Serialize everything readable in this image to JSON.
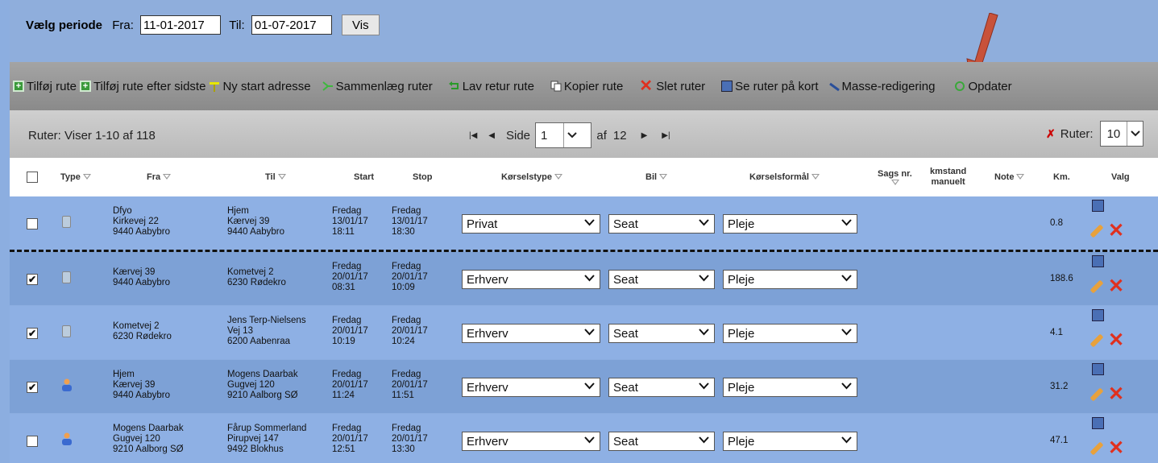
{
  "period": {
    "label": "Vælg periode",
    "from_label": "Fra:",
    "from_value": "11-01-2017",
    "to_label": "Til:",
    "to_value": "01-07-2017",
    "show_button": "Vis"
  },
  "toolbar": [
    {
      "label": "Tilføj rute",
      "icon": "add-icon"
    },
    {
      "label": "Tilføj rute efter sidste",
      "icon": "add-icon"
    },
    {
      "label": "Ny start adresse",
      "icon": "pin-icon"
    },
    {
      "label": "Sammenlæg ruter",
      "icon": "merge-icon"
    },
    {
      "label": "Lav retur rute",
      "icon": "return-icon"
    },
    {
      "label": "Kopier rute",
      "icon": "copy-icon"
    },
    {
      "label": "Slet ruter",
      "icon": "delete-icon"
    },
    {
      "label": "Se ruter på kort",
      "icon": "map-icon"
    },
    {
      "label": "Masse-redigering",
      "icon": "pencil-icon"
    },
    {
      "label": "Opdater",
      "icon": "refresh-icon"
    }
  ],
  "pager": {
    "info": "Ruter: Viser 1-10 af 118",
    "side_label": "Side",
    "page": "1",
    "of_label": "af",
    "total_pages": "12",
    "rows_label": "Ruter:",
    "rows_value": "10"
  },
  "columns": {
    "type": "Type",
    "from": "Fra",
    "to": "Til",
    "start": "Start",
    "stop": "Stop",
    "drive_type": "Kørselstype",
    "car": "Bil",
    "purpose": "Kørselsformål",
    "case_nr_1": "Sags nr.",
    "km_manual_1": "kmstand",
    "km_manual_2": "manuelt",
    "note": "Note",
    "km": "Km.",
    "choice": "Valg"
  },
  "rows": [
    {
      "checked": false,
      "type": "car",
      "from": [
        "Dfyo",
        "Kirkevej 22",
        "9440 Aabybro"
      ],
      "to": [
        "Hjem",
        "Kærvej 39",
        "9440 Aabybro"
      ],
      "start": [
        "Fredag",
        "13/01/17",
        "18:11"
      ],
      "stop": [
        "Fredag",
        "13/01/17",
        "18:30"
      ],
      "drive_type": "Privat",
      "car": "Seat",
      "purpose": "Pleje",
      "km": "0.8",
      "check": ""
    },
    {
      "checked": true,
      "type": "car",
      "from": [
        "Kærvej 39",
        "9440 Aabybro"
      ],
      "to": [
        "Kometvej 2",
        "6230 Rødekro"
      ],
      "start": [
        "Fredag",
        "20/01/17",
        "08:31"
      ],
      "stop": [
        "Fredag",
        "20/01/17",
        "10:09"
      ],
      "drive_type": "Erhverv",
      "car": "Seat",
      "purpose": "Pleje",
      "km": "188.6",
      "check": "✔"
    },
    {
      "checked": true,
      "type": "car",
      "from": [
        "Kometvej 2",
        "6230 Rødekro"
      ],
      "to": [
        "Jens Terp-Nielsens",
        "Vej 13",
        "6200 Aabenraa"
      ],
      "start": [
        "Fredag",
        "20/01/17",
        "10:19"
      ],
      "stop": [
        "Fredag",
        "20/01/17",
        "10:24"
      ],
      "drive_type": "Erhverv",
      "car": "Seat",
      "purpose": "Pleje",
      "km": "4.1",
      "check": "✔"
    },
    {
      "checked": true,
      "type": "person",
      "from": [
        "Hjem",
        "Kærvej 39",
        "9440 Aabybro"
      ],
      "to": [
        "Mogens Daarbak",
        "Gugvej 120",
        "9210 Aalborg SØ"
      ],
      "start": [
        "Fredag",
        "20/01/17",
        "11:24"
      ],
      "stop": [
        "Fredag",
        "20/01/17",
        "11:51"
      ],
      "drive_type": "Erhverv",
      "car": "Seat",
      "purpose": "Pleje",
      "km": "31.2",
      "check": "✔"
    },
    {
      "checked": false,
      "type": "person",
      "from": [
        "Mogens Daarbak",
        "Gugvej 120",
        "9210 Aalborg SØ"
      ],
      "to": [
        "Fårup Sommerland",
        "Pirupvej 147",
        "9492 Blokhus"
      ],
      "start": [
        "Fredag",
        "20/01/17",
        "12:51"
      ],
      "stop": [
        "Fredag",
        "20/01/17",
        "13:30"
      ],
      "drive_type": "Erhverv",
      "car": "Seat",
      "purpose": "Pleje",
      "km": "47.1",
      "check": ""
    }
  ],
  "colors": {
    "row_even": "#8eb0e4",
    "row_odd": "#7da1d6",
    "arrow": "#c8523a",
    "delete": "#e0301e"
  }
}
